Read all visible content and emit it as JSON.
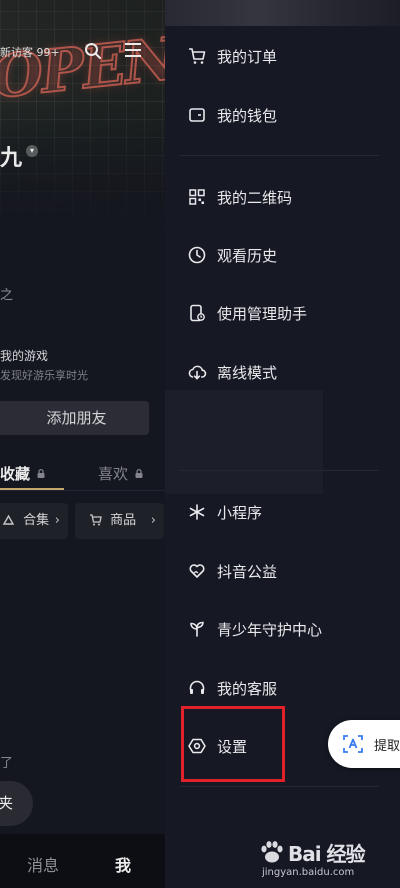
{
  "profile": {
    "visitors_text": "新访客 99+",
    "name_fragment": "九",
    "bio_fragment": "之",
    "game_title": "我的游戏",
    "game_subtitle": "发现好游乐享时光",
    "add_friend_label": "添加朋友",
    "tabs": [
      {
        "label": "收藏",
        "locked": true,
        "active": true
      },
      {
        "label": "喜欢",
        "locked": true,
        "active": false
      }
    ],
    "chips": [
      {
        "label": "合集",
        "icon": "collection-icon"
      },
      {
        "label": "商品",
        "icon": "cart-icon"
      }
    ],
    "chip_arrow": "›",
    "bottom_text_fragment": "了",
    "bottom_button_fragment": "夹",
    "bottom_nav": {
      "messages": "消息",
      "me": "我"
    }
  },
  "drawer": {
    "items": [
      {
        "label": "我的订单",
        "icon": "cart-icon"
      },
      {
        "label": "我的钱包",
        "icon": "wallet-icon"
      },
      {
        "label": "我的二维码",
        "icon": "qr-code-icon"
      },
      {
        "label": "观看历史",
        "icon": "clock-icon"
      },
      {
        "label": "使用管理助手",
        "icon": "phone-manage-icon"
      },
      {
        "label": "离线模式",
        "icon": "cloud-download-icon"
      },
      {
        "label": "小程序",
        "icon": "asterisk-icon"
      },
      {
        "label": "抖音公益",
        "icon": "heart-hands-icon"
      },
      {
        "label": "青少年守护中心",
        "icon": "sprout-icon"
      },
      {
        "label": "我的客服",
        "icon": "headset-icon"
      },
      {
        "label": "设置",
        "icon": "settings-hex-icon"
      }
    ]
  },
  "floating": {
    "label": "提取"
  },
  "watermark": {
    "brand": "Bai 经验",
    "url": "jingyan.baidu.com"
  },
  "colors": {
    "background": "#161823",
    "tab_underline": "#d4b676",
    "highlight": "#e0202a"
  }
}
